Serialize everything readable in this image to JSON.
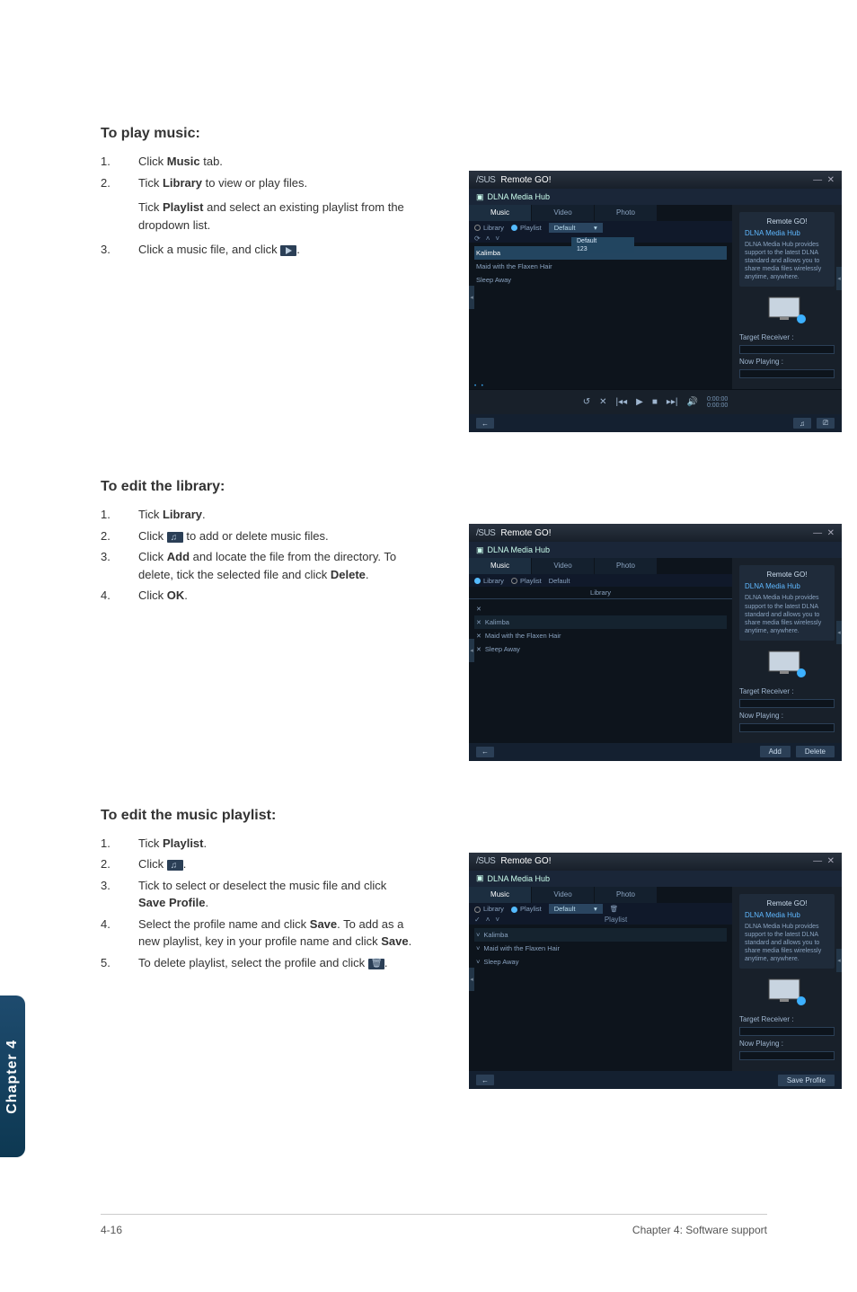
{
  "sections": {
    "play": {
      "heading": "To play music:",
      "steps": [
        {
          "num": "1.",
          "prefix": "Click ",
          "bold": "Music",
          "suffix": " tab."
        },
        {
          "num": "2.",
          "prefix": "Tick ",
          "bold": "Library",
          "suffix": " to view or play files."
        },
        {
          "num": "",
          "prefix": "Tick ",
          "bold": "Playlist",
          "suffix": " and select an existing playlist from the dropdown list."
        },
        {
          "num": "3.",
          "prefix": "Click a music file, and click ",
          "bold": "",
          "suffix": "."
        }
      ]
    },
    "editLibrary": {
      "heading": "To edit the library:",
      "steps": [
        {
          "num": "1.",
          "prefix": "Tick ",
          "bold": "Library",
          "suffix": "."
        },
        {
          "num": "2.",
          "prefix": "Click ",
          "bold": "",
          "suffix": " to add or delete music files."
        },
        {
          "num": "3.",
          "prefix": "Click ",
          "bold": "Add",
          "suffix": " and locate the file from the directory. To delete, tick the selected file and click ",
          "bold2": "Delete",
          "suffix2": "."
        },
        {
          "num": "4.",
          "prefix": "Click ",
          "bold": "OK",
          "suffix": "."
        }
      ]
    },
    "editPlaylist": {
      "heading": "To edit the music playlist:",
      "steps": [
        {
          "num": "1.",
          "prefix": "Tick ",
          "bold": "Playlist",
          "suffix": "."
        },
        {
          "num": "2.",
          "prefix": "Click ",
          "bold": "",
          "suffix": "."
        },
        {
          "num": "3.",
          "prefix": "Tick to select or deselect the music file and click ",
          "bold": "Save Profile",
          "suffix": "."
        },
        {
          "num": "4.",
          "prefix": "Select the profile name and click ",
          "bold": "Save",
          "suffix": ". To add as a new playlist, key in your profile name and click ",
          "bold2": "Save",
          "suffix2": "."
        },
        {
          "num": "5.",
          "prefix": "To delete playlist, select the profile and click ",
          "bold": "",
          "suffix": "."
        }
      ]
    }
  },
  "screenshot": {
    "brand": "/SUS",
    "appTitle": "Remote GO!",
    "subtitle": "DLNA Media Hub",
    "sideTitle": "Remote GO!",
    "sideHeading": "DLNA Media Hub",
    "sideDesc": "DLNA Media Hub provides support to the latest DLNA standard and allows you to share media files wirelessly anytime, anywhere.",
    "targetLabel": "Target Receiver :",
    "nowPlaying": "Now Playing :",
    "tabs": {
      "music": "Music",
      "video": "Video",
      "photo": "Photo"
    },
    "filters": {
      "library": "Library",
      "playlist": "Playlist",
      "default": "Default",
      "libraryMode": "Library",
      "playlistMode": "Playlist"
    },
    "dropdown": {
      "default": "Default",
      "opt123": "123"
    },
    "tracks": {
      "kalimba": "Kalimba",
      "maid": "Maid with the Flaxen Hair",
      "sleep": "Sleep Away"
    },
    "time": {
      "elapsed": "0:00:00",
      "total": "0:00:00"
    },
    "buttons": {
      "add": "Add",
      "delete": "Delete",
      "saveProfile": "Save Profile"
    }
  },
  "sidebarTab": "Chapter 4",
  "footer": {
    "pageNum": "4-16",
    "chapterTitle": "Chapter 4: Software support"
  }
}
